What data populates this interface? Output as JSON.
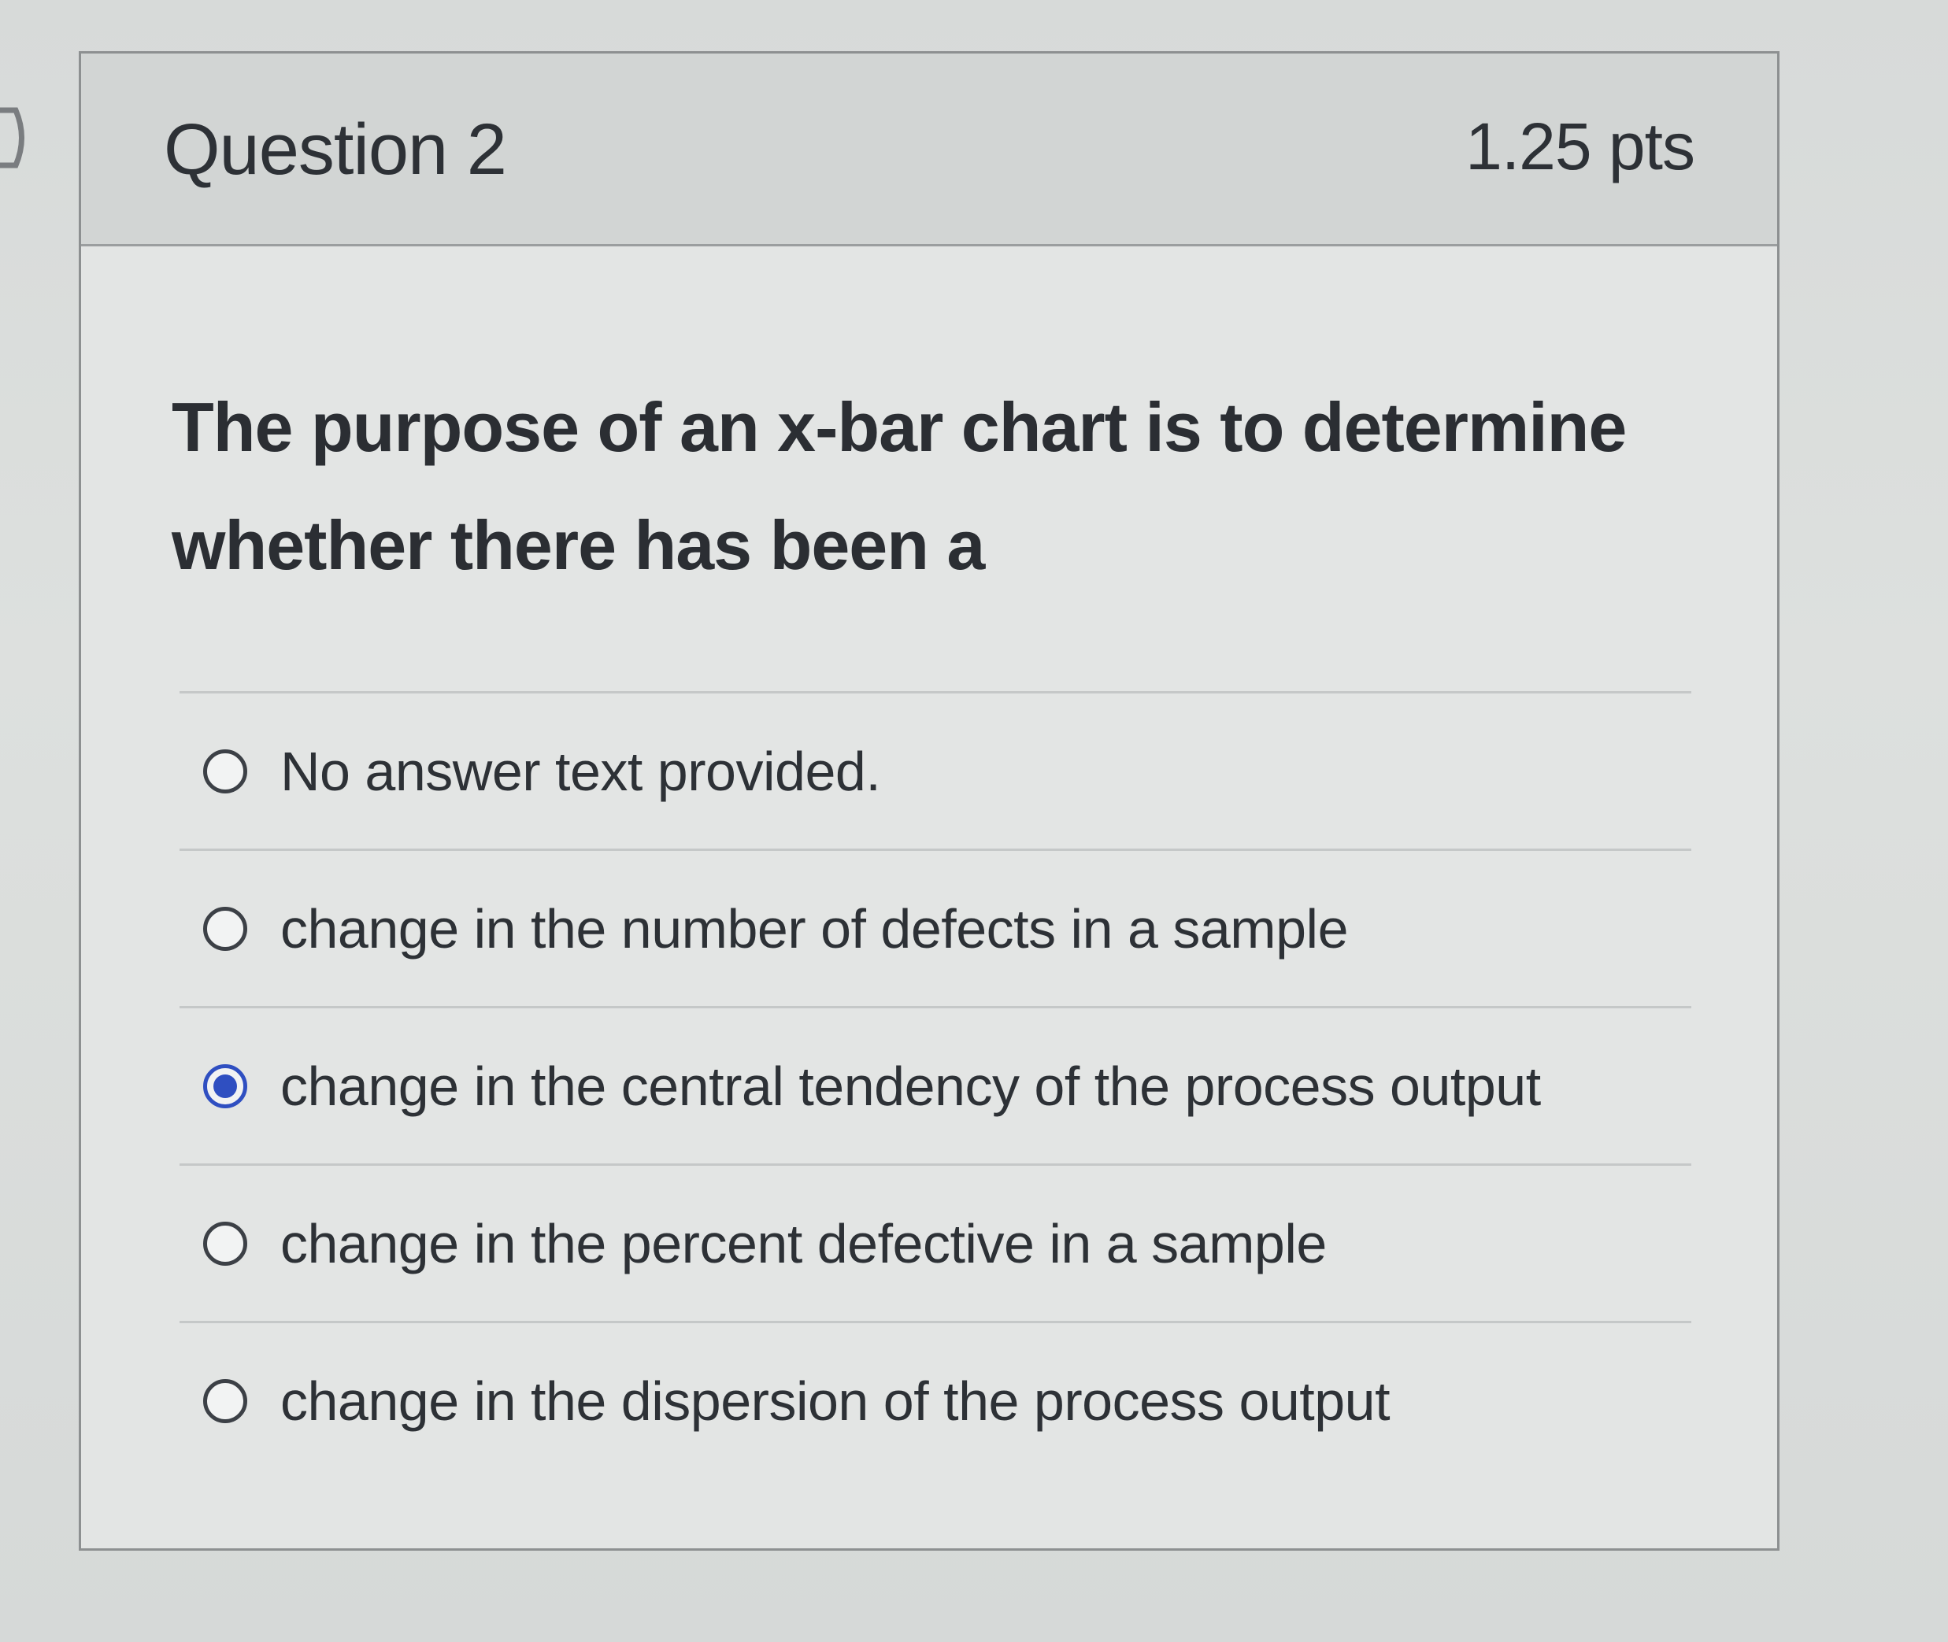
{
  "question": {
    "title": "Question 2",
    "points": "1.25 pts",
    "text": "The purpose of an x-bar chart is to determine whether there has been a"
  },
  "answers": [
    {
      "label": "No answer text provided.",
      "selected": false
    },
    {
      "label": "change in the number of defects in a sample",
      "selected": false
    },
    {
      "label": "change in the central tendency of the process output",
      "selected": true
    },
    {
      "label": "change in the percent defective in a sample",
      "selected": false
    },
    {
      "label": "change in the dispersion of the process output",
      "selected": false
    }
  ],
  "colors": {
    "selected_radio": "#2f4fc1",
    "text": "#2d3136",
    "header_bg": "#d2d5d4"
  },
  "icons": {
    "nav": "chevron-right-icon"
  }
}
